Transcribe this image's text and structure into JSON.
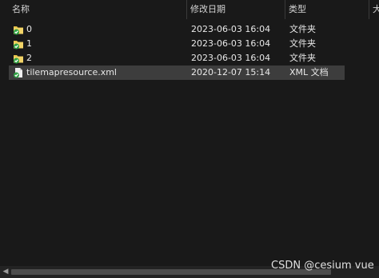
{
  "header": {
    "name_label": "名称",
    "date_label": "修改日期",
    "type_label": "类型",
    "size_label": "大",
    "sort_arrow": "^"
  },
  "files": [
    {
      "name": "0",
      "date": "2023-06-03 16:04",
      "type": "文件夹",
      "icon": "folder-icon",
      "selected": false
    },
    {
      "name": "1",
      "date": "2023-06-03 16:04",
      "type": "文件夹",
      "icon": "folder-icon",
      "selected": false
    },
    {
      "name": "2",
      "date": "2023-06-03 16:04",
      "type": "文件夹",
      "icon": "folder-icon",
      "selected": false
    },
    {
      "name": "tilemapresource.xml",
      "date": "2020-12-07 15:14",
      "type": "XML 文档",
      "icon": "xml-file-icon",
      "selected": true
    }
  ],
  "scrollbar": {
    "left_arrow": "◀"
  },
  "watermark": "CSDN @cesium vue",
  "colors": {
    "background": "#191919",
    "selected_row": "#3d3d3d",
    "folder_yellow": "#e8c44a",
    "sync_green": "#2ea043"
  }
}
